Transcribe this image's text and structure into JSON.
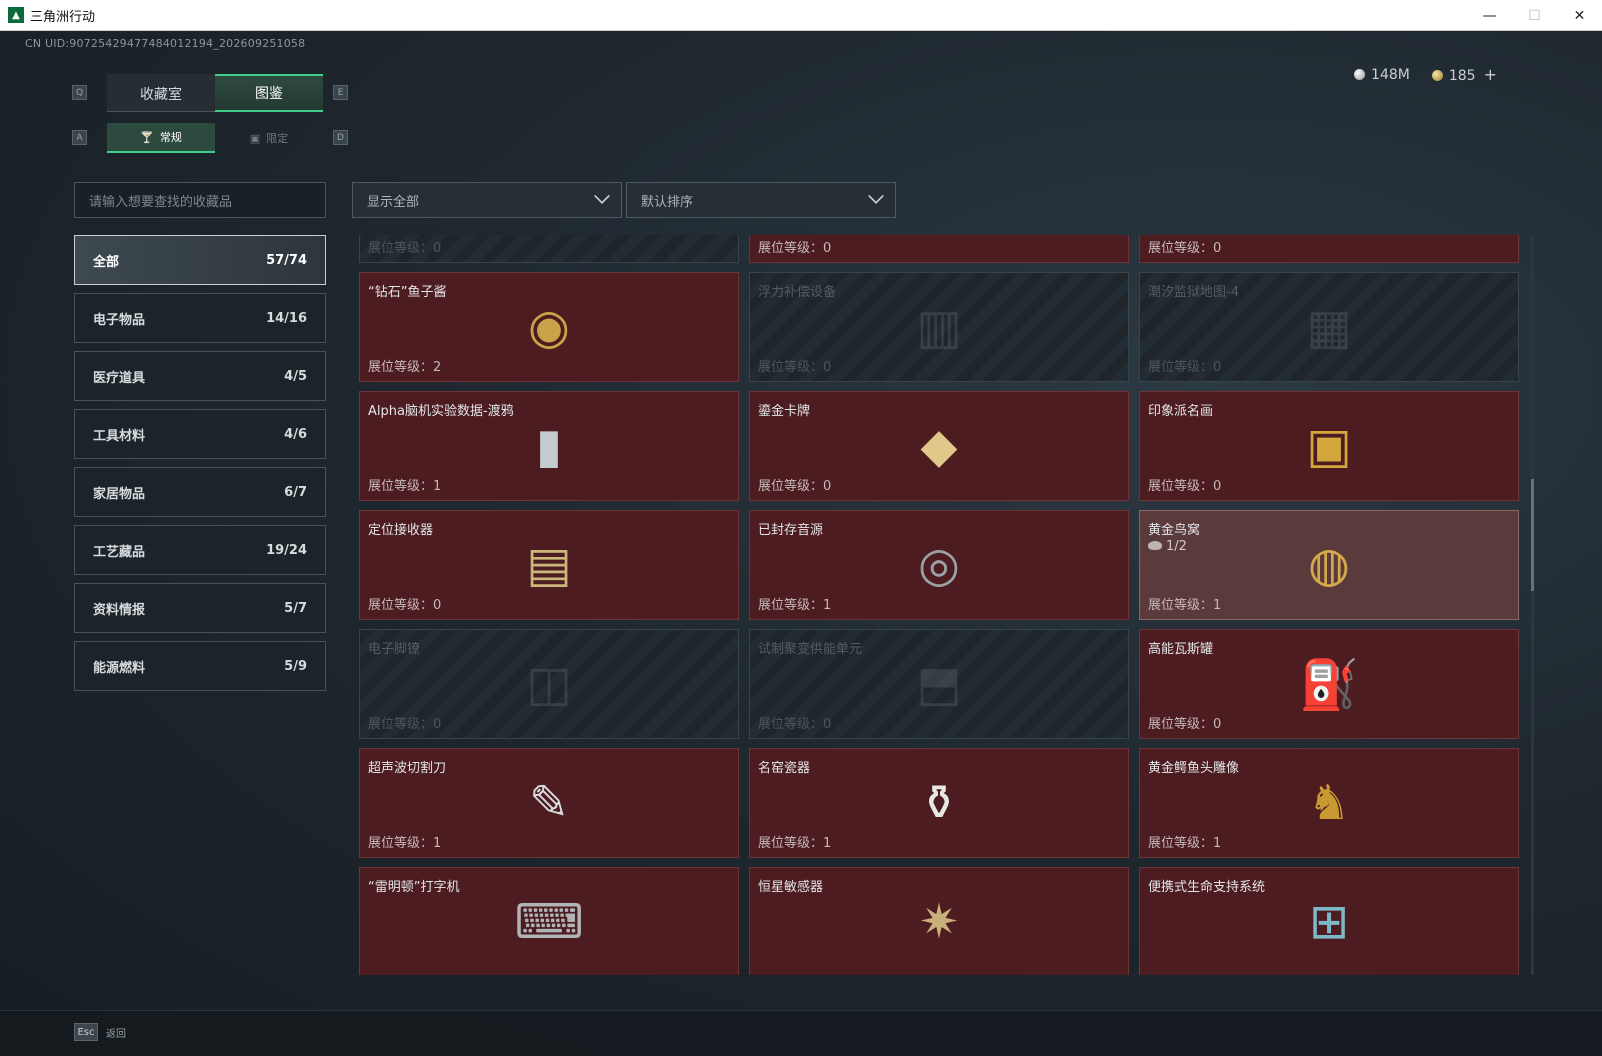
{
  "window": {
    "title": "三角洲行动",
    "minimize": "—",
    "maximize": "☐",
    "close": "✕"
  },
  "uid": "CN UID:9072542947748401​2194_202609251058",
  "currency": {
    "silver": "148M",
    "gold": "185",
    "plus": "+"
  },
  "hotkeys": {
    "q": "Q",
    "e": "E",
    "a": "A",
    "d": "D"
  },
  "main_tabs": [
    {
      "label": "收藏室"
    },
    {
      "label": "图鉴"
    }
  ],
  "sub_tabs": [
    {
      "label": "常规"
    },
    {
      "label": "限定"
    }
  ],
  "search": {
    "placeholder": "请输入想要查找的收藏品"
  },
  "filters": {
    "display": "显示全部",
    "sort": "默认排序"
  },
  "categories": [
    {
      "label": "全部",
      "count": "57/74"
    },
    {
      "label": "电子物品",
      "count": "14/16"
    },
    {
      "label": "医疗道具",
      "count": "4/5"
    },
    {
      "label": "工具材料",
      "count": "4/6"
    },
    {
      "label": "家居物品",
      "count": "6/7"
    },
    {
      "label": "工艺藏品",
      "count": "19/24"
    },
    {
      "label": "资料情报",
      "count": "5/7"
    },
    {
      "label": "能源燃料",
      "count": "5/9"
    }
  ],
  "cards": [
    {
      "name": "",
      "level": "展位等级：0",
      "locked": true,
      "icon": "trophy-icon"
    },
    {
      "name": "",
      "level": "展位等级：0",
      "locked": false,
      "icon": "chess-box-icon"
    },
    {
      "name": "",
      "level": "展位等级：0",
      "locked": false,
      "icon": "machine-icon"
    },
    {
      "name": "“钻石”鱼子酱",
      "level": "展位等级：2",
      "locked": false,
      "icon": "caviar-tin-icon"
    },
    {
      "name": "浮力补偿设备",
      "level": "展位等级：0",
      "locked": true,
      "icon": "vest-icon"
    },
    {
      "name": "潮汐监狱地图-4",
      "level": "展位等级：0",
      "locked": true,
      "icon": "map-icon"
    },
    {
      "name": "Alpha脑机实验数据-渡鸦",
      "level": "展位等级：1",
      "locked": false,
      "icon": "data-cylinder-icon"
    },
    {
      "name": "鎏金卡牌",
      "level": "展位等级：0",
      "locked": false,
      "icon": "card-icon"
    },
    {
      "name": "印象派名画",
      "level": "展位等级：0",
      "locked": false,
      "icon": "painting-icon"
    },
    {
      "name": "定位接收器",
      "level": "展位等级：0",
      "locked": false,
      "icon": "receiver-icon"
    },
    {
      "name": "已封存音源",
      "level": "展位等级：1",
      "locked": false,
      "icon": "tape-recorder-icon"
    },
    {
      "name": "黄金鸟窝",
      "level": "展位等级：1",
      "locked": false,
      "icon": "golden-nest-icon",
      "count": "1/2",
      "highlight": true
    },
    {
      "name": "电子脚镣",
      "level": "展位等级：0",
      "locked": true,
      "icon": "ankle-monitor-icon"
    },
    {
      "name": "试制聚变供能单元",
      "level": "展位等级：0",
      "locked": true,
      "icon": "fusion-cell-icon"
    },
    {
      "name": "高能瓦斯罐",
      "level": "展位等级：0",
      "locked": false,
      "icon": "gas-canister-icon"
    },
    {
      "name": "超声波切割刀",
      "level": "展位等级：1",
      "locked": false,
      "icon": "cutter-icon"
    },
    {
      "name": "名窑瓷器",
      "level": "展位等级：1",
      "locked": false,
      "icon": "porcelain-vase-icon"
    },
    {
      "name": "黄金鳄鱼头雕像",
      "level": "展位等级：1",
      "locked": false,
      "icon": "crocodile-statue-icon"
    },
    {
      "name": "“雷明顿”打字机",
      "level": "",
      "locked": false,
      "icon": "typewriter-icon"
    },
    {
      "name": "恒星敏感器",
      "level": "",
      "locked": false,
      "icon": "star-sensor-icon"
    },
    {
      "name": "便携式生命支持系统",
      "level": "",
      "locked": false,
      "icon": "life-support-icon"
    }
  ],
  "footer": {
    "esc_key": "Esc",
    "back_label": "返回"
  },
  "colors": {
    "accent": "#3fcf8a",
    "card_owned": "#4c1c20",
    "card_locked": "#1e262c"
  }
}
